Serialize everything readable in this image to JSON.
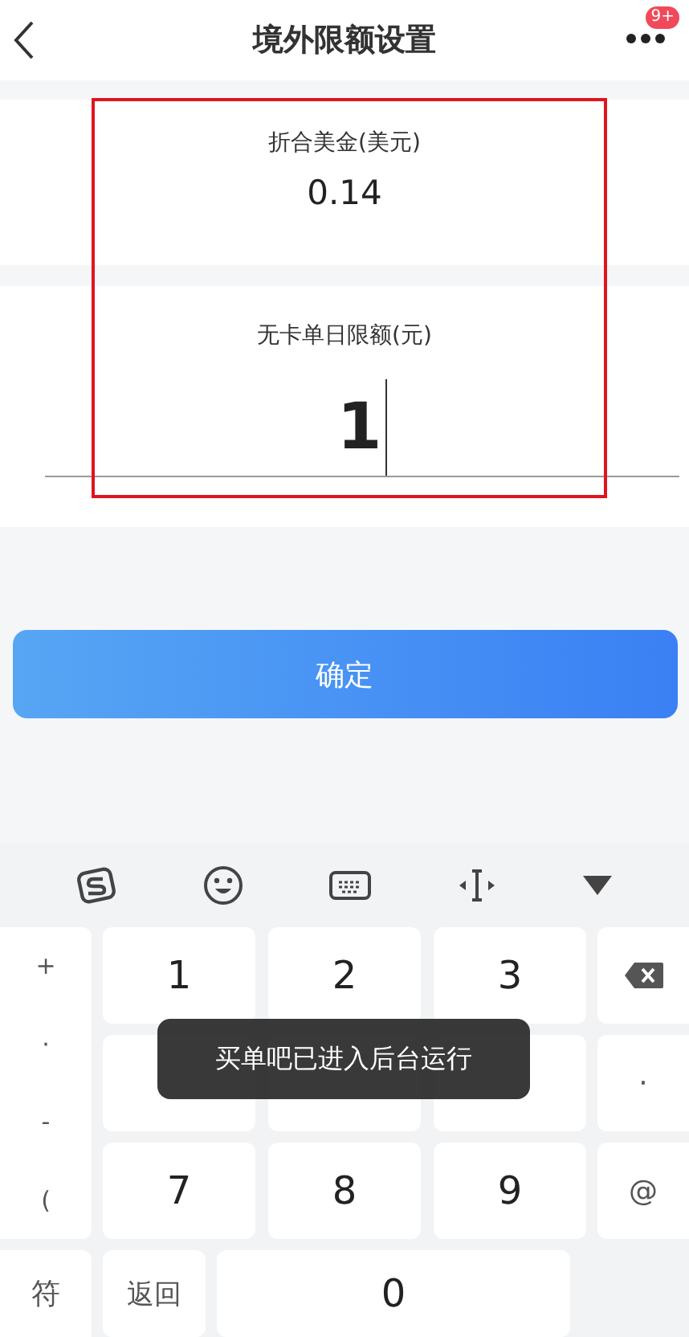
{
  "header": {
    "title": "境外限额设置",
    "badge": "9+"
  },
  "usd": {
    "label": "折合美金(美元)",
    "value": "0.14"
  },
  "limit": {
    "label": "无卡单日限额(元)",
    "value": "1"
  },
  "confirm": "确定",
  "keyboard": {
    "symbols": [
      "+",
      "·",
      "-",
      "("
    ],
    "rows": [
      [
        {
          "kind": "digit",
          "label": "1"
        },
        {
          "kind": "digit",
          "label": "2"
        },
        {
          "kind": "digit",
          "label": "3"
        }
      ],
      [
        {
          "kind": "covered"
        },
        {
          "kind": "covered"
        },
        {
          "kind": "covered"
        }
      ],
      [
        {
          "kind": "digit",
          "label": "7"
        },
        {
          "kind": "digit",
          "label": "8"
        },
        {
          "kind": "digit",
          "label": "9"
        }
      ]
    ],
    "side": [
      {
        "kind": "backspace"
      },
      {
        "kind": "text",
        "label": "·"
      },
      {
        "kind": "text",
        "label": "@"
      }
    ],
    "bottom": [
      {
        "kind": "narrow",
        "label": "符"
      },
      {
        "kind": "key",
        "label": "返回"
      },
      {
        "kind": "wide",
        "label": "0"
      }
    ]
  },
  "toast": "买单吧已进入后台运行"
}
